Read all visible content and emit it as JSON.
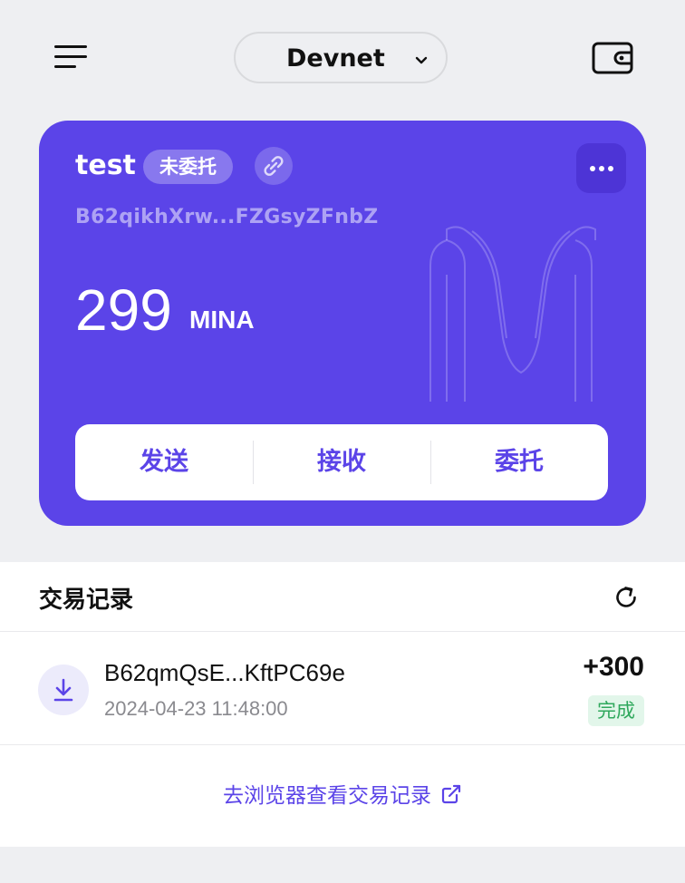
{
  "header": {
    "network": "Devnet",
    "menu_icon": "hamburger-menu-icon",
    "wallet_icon": "wallet-icon"
  },
  "account": {
    "name": "test",
    "delegation_badge": "未委托",
    "address": "B62qikhXrw...FZGsyZFnbZ",
    "balance": "299",
    "unit": "MINA",
    "actions": {
      "send": "发送",
      "receive": "接收",
      "delegate": "委托"
    }
  },
  "transactions": {
    "title": "交易记录",
    "items": [
      {
        "address": "B62qmQsE...KftPC69e",
        "time": "2024-04-23 11:48:00",
        "amount": "+300",
        "status": "完成",
        "icon": "receive-arrow-icon"
      }
    ],
    "explorer_link": "去浏览器查看交易记录"
  },
  "colors": {
    "accent": "#5b44e8",
    "background": "#eeeff2",
    "success": "#2fa85c"
  }
}
